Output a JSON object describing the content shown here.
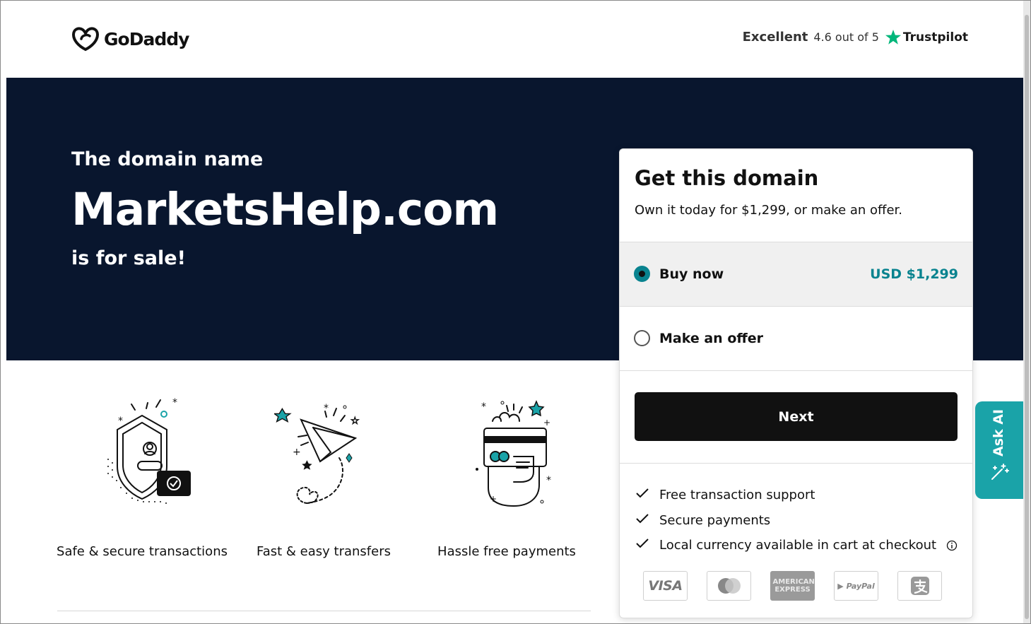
{
  "header": {
    "logo_text": "GoDaddy",
    "trust_excellent": "Excellent",
    "trust_rating": "4.6 out of 5",
    "trust_brand": "Trustpilot"
  },
  "hero": {
    "prefix": "The domain name",
    "domain": "MarketsHelp.com",
    "suffix": "is for sale!"
  },
  "features": [
    {
      "label": "Safe & secure transactions",
      "icon": "shield-icon"
    },
    {
      "label": "Fast & easy transfers",
      "icon": "paper-plane-icon"
    },
    {
      "label": "Hassle free payments",
      "icon": "card-payment-icon"
    }
  ],
  "card": {
    "title": "Get this domain",
    "subtitle": "Own it today for $1,299, or make an offer.",
    "options": [
      {
        "label": "Buy now",
        "price": "USD $1,299",
        "selected": true
      },
      {
        "label": "Make an offer",
        "price": "",
        "selected": false
      }
    ],
    "next_label": "Next",
    "perks": [
      "Free transaction support",
      "Secure payments",
      "Local currency available in cart at checkout"
    ],
    "payment_methods": [
      "VISA",
      "Mastercard",
      "AMERICAN EXPRESS",
      "PayPal",
      "Alipay"
    ]
  },
  "ask_ai": {
    "label": "Ask AI"
  },
  "colors": {
    "hero_bg": "#09162e",
    "accent": "#09838f",
    "ask_ai_bg": "#1aa3a8",
    "trustpilot": "#00b67a"
  }
}
